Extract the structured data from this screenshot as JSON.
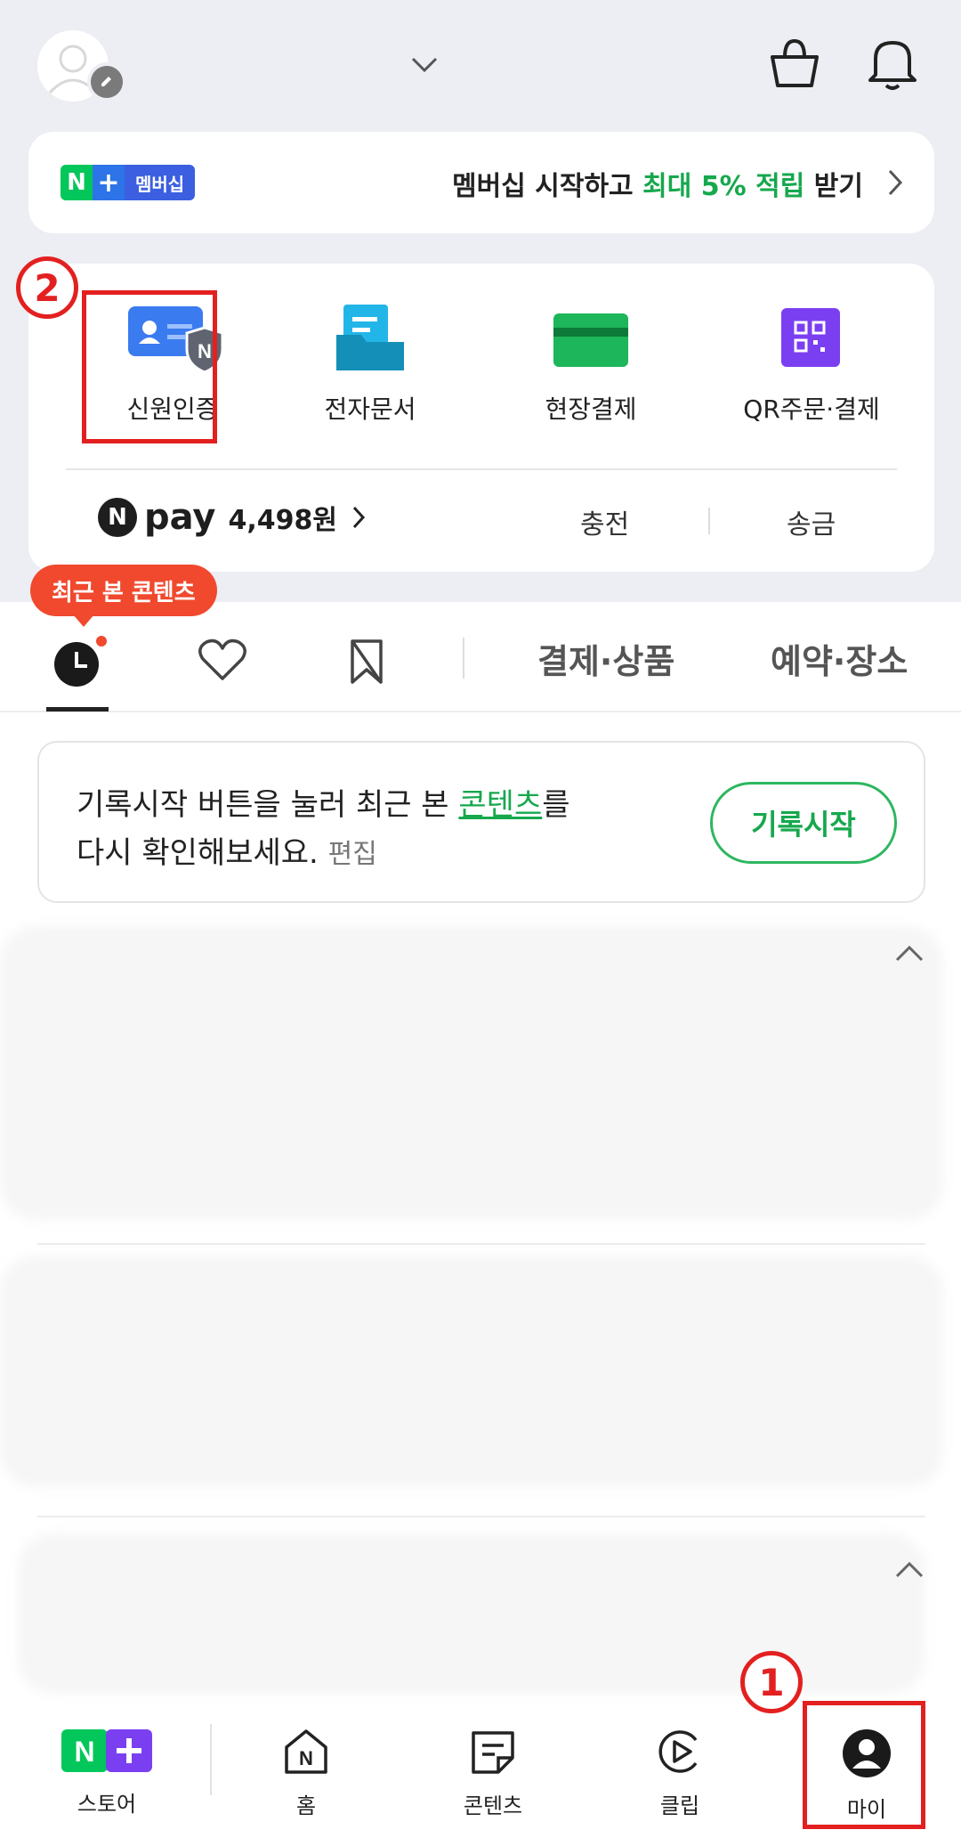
{
  "membership": {
    "badge_n": "N",
    "badge_plus": "+",
    "badge_label": "멤버십",
    "text_prefix": "멤버십 시작하고 ",
    "text_highlight": "최대 5% 적립",
    "text_suffix": " 받기"
  },
  "quick_actions": [
    {
      "label": "신원인증",
      "icon": "id-card-shield-icon"
    },
    {
      "label": "전자문서",
      "icon": "document-folder-icon"
    },
    {
      "label": "현장결제",
      "icon": "card-icon"
    },
    {
      "label": "QR주문·결제",
      "icon": "qr-icon"
    }
  ],
  "npay": {
    "circle_letter": "N",
    "pay_label": "pay",
    "balance": "4,498원",
    "charge_label": "충전",
    "send_label": "송금"
  },
  "annotations": {
    "one": "1",
    "two": "2"
  },
  "tooltip": "최근 본 콘텐츠",
  "tabs": {
    "payments": "결제·상품",
    "reservations": "예약·장소"
  },
  "info_card": {
    "line1_prefix": "기록시작 버튼을 눌러 최근 본 ",
    "line1_link": "콘텐츠",
    "line1_suffix": "를",
    "line2": "다시 확인해보세요.",
    "edit": "편집",
    "button": "기록시작"
  },
  "bottom_nav": [
    {
      "label": "스토어",
      "icon": "n-plus-store-icon"
    },
    {
      "label": "홈",
      "icon": "n-home-icon"
    },
    {
      "label": "콘텐츠",
      "icon": "contents-icon"
    },
    {
      "label": "클립",
      "icon": "clip-icon"
    },
    {
      "label": "마이",
      "icon": "profile-icon"
    }
  ],
  "colors": {
    "naver_green": "#03c75a",
    "highlight_green": "#16a84d",
    "annotation_red": "#e32020",
    "tooltip_red": "#f0492e",
    "top_background": "#eceef3"
  }
}
